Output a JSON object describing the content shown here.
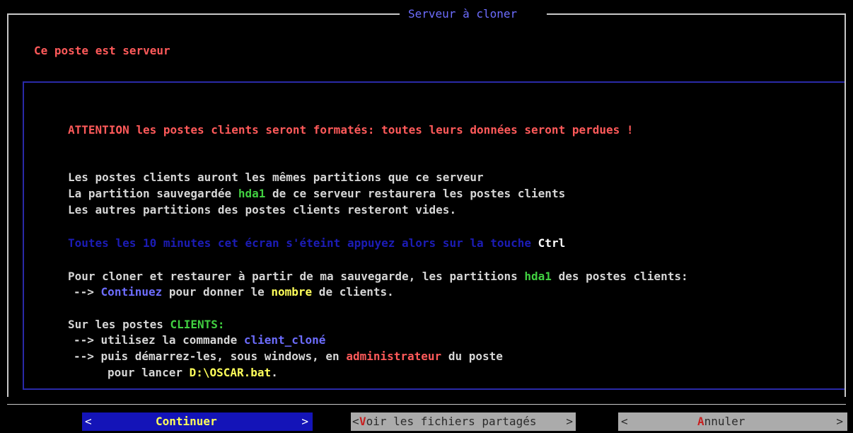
{
  "window": {
    "title": "Serveur à cloner"
  },
  "server_status": "Ce poste est serveur",
  "content": {
    "warning": "ATTENTION les postes clients seront formatés: toutes leurs données seront perdues !",
    "info_line1": "Les postes clients auront les mêmes partitions que ce serveur",
    "info_line2_prefix": "La partition sauvegardée ",
    "partition": "hda1",
    "info_line2_suffix": " de ce serveur restaurera les postes clients",
    "info_line3": "Les autres partitions des postes clients resteront vides.",
    "screen_notice": "Toutes les 10 minutes cet écran s'éteint appuyez alors sur la touche ",
    "key": "Ctrl",
    "clone_intro_prefix": "Pour cloner et restaurer à partir de ma sauvegarde, les partitions ",
    "clone_intro_suffix": " des postes clients:",
    "arrow": "-->",
    "continue_word": "Continuez",
    "continue_mid": " pour donner le ",
    "count_word": "nombre",
    "continue_end": " de clients.",
    "clients_prefix": "Sur les postes ",
    "clients_word": "CLIENTS:",
    "cmd_prefix": " utilisez la commande ",
    "cmd_name": "client_cloné",
    "boot_prefix": " puis démarrez-les, sous windows, en ",
    "admin_word": "administrateur",
    "boot_suffix": " du poste",
    "launch_prefix": "pour lancer ",
    "launch_file": "D:\\OSCAR.bat",
    "launch_suffix": "."
  },
  "buttons": {
    "continue": {
      "lt": "<",
      "label": "Continuer",
      "gt": ">"
    },
    "voir": {
      "lt": "<",
      "hotkey": "V",
      "label": "oir les fichiers partagés",
      "gt": ">"
    },
    "annuler": {
      "lt": "<",
      "hotkey": "A",
      "label": "nnuler",
      "gt": ">"
    }
  }
}
